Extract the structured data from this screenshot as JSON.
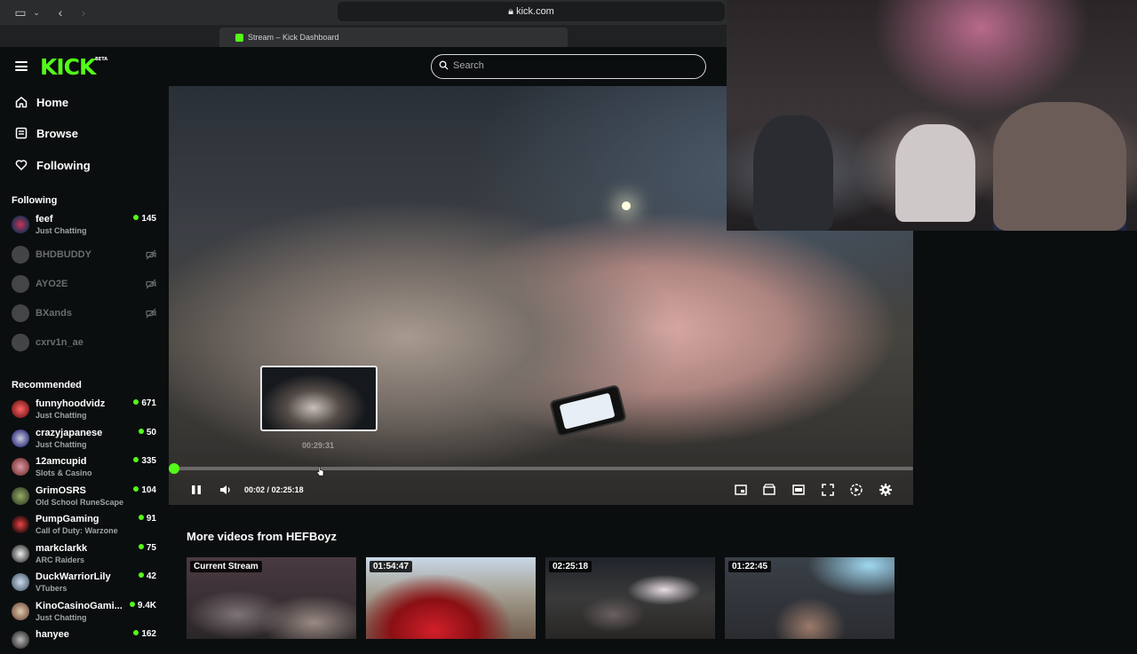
{
  "browser": {
    "url": "kick.com",
    "tab_title": "Stream – Kick Dashboard"
  },
  "header": {
    "logo": "KICK",
    "logo_badge": "BETA",
    "search_placeholder": "Search"
  },
  "nav": [
    {
      "label": "Home",
      "icon": "home-icon"
    },
    {
      "label": "Browse",
      "icon": "browse-icon"
    },
    {
      "label": "Following",
      "icon": "heart-icon"
    }
  ],
  "sidebar": {
    "following_title": "Following",
    "recommended_title": "Recommended",
    "following": [
      {
        "name": "feef",
        "category": "Just Chatting",
        "viewers": "145",
        "live": true
      },
      {
        "name": "BHDBUDDY",
        "live": false
      },
      {
        "name": "AYO2E",
        "live": false
      },
      {
        "name": "BXands",
        "live": false
      },
      {
        "name": "cxrv1n_ae",
        "live": false
      }
    ],
    "recommended": [
      {
        "name": "funnyhoodvidz",
        "category": "Just Chatting",
        "viewers": "671"
      },
      {
        "name": "crazyjapanese",
        "category": "Just Chatting",
        "viewers": "50"
      },
      {
        "name": "12amcupid",
        "category": "Slots & Casino",
        "viewers": "335"
      },
      {
        "name": "GrimOSRS",
        "category": "Old School RuneScape",
        "viewers": "104"
      },
      {
        "name": "PumpGaming",
        "category": "Call of Duty: Warzone",
        "viewers": "91"
      },
      {
        "name": "markclarkk",
        "category": "ARC Raiders",
        "viewers": "75"
      },
      {
        "name": "DuckWarriorLily",
        "category": "VTubers",
        "viewers": "42"
      },
      {
        "name": "KinoCasinoGami...",
        "category": "Just Chatting",
        "viewers": "9.4K"
      },
      {
        "name": "hanyee",
        "category": "",
        "viewers": "162"
      }
    ]
  },
  "player": {
    "current_time": "00:02",
    "separator": "/",
    "duration": "02:25:18",
    "preview_time": "00:29:31",
    "progress_fraction": 0.0003,
    "accent": "#53fc18"
  },
  "more_videos": {
    "title": "More videos from HEFBoyz",
    "items": [
      {
        "label": "Current Stream"
      },
      {
        "label": "01:54:47"
      },
      {
        "label": "02:25:18"
      },
      {
        "label": "01:22:45"
      }
    ]
  }
}
